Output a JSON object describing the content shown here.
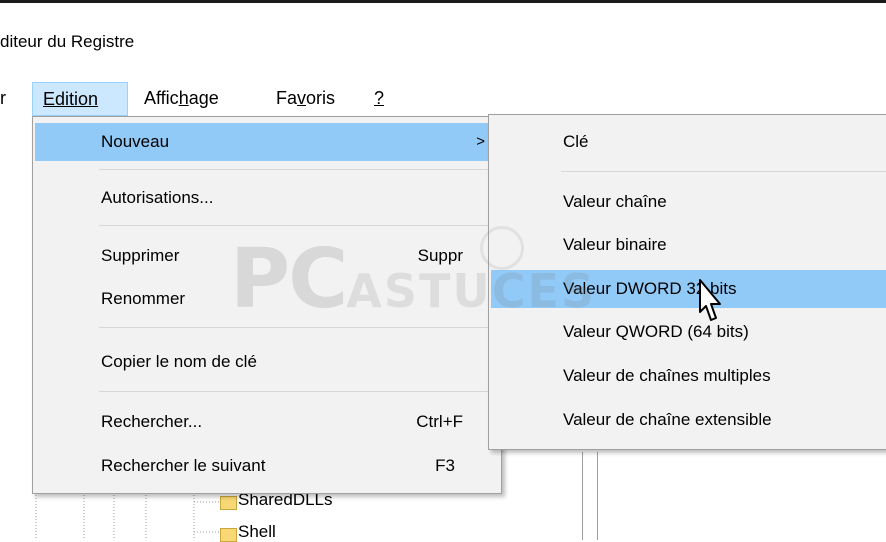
{
  "window": {
    "title": "diteur du Registre"
  },
  "menubar": {
    "items": [
      {
        "id": "fichier",
        "label": "r"
      },
      {
        "id": "edition",
        "label": "Edition",
        "accel_index": 0,
        "active": true
      },
      {
        "id": "affichage",
        "label": "Affichage",
        "accel_index": 5
      },
      {
        "id": "favoris",
        "label": "Favoris",
        "accel_index": 2
      },
      {
        "id": "aide",
        "label": "?",
        "accel_index": 0
      }
    ]
  },
  "edit_menu": {
    "items": [
      {
        "label": "Nouveau",
        "shortcut": "",
        "submenu_arrow": ">",
        "highlighted": true
      },
      {
        "label": "Autorisations...",
        "shortcut": ""
      },
      {
        "label": "Supprimer",
        "shortcut": "Suppr"
      },
      {
        "label": "Renommer",
        "shortcut": ""
      },
      {
        "label": "Copier le nom de clé",
        "shortcut": ""
      },
      {
        "label": "Rechercher...",
        "shortcut": "Ctrl+F"
      },
      {
        "label": "Rechercher le suivant",
        "shortcut": "F3"
      }
    ]
  },
  "new_submenu": {
    "items": [
      {
        "label": "Clé"
      },
      {
        "label": "Valeur chaîne"
      },
      {
        "label": "Valeur binaire"
      },
      {
        "label": "Valeur DWORD 32 bits",
        "highlighted": true
      },
      {
        "label": "Valeur QWORD (64 bits)"
      },
      {
        "label": "Valeur de chaînes multiples"
      },
      {
        "label": "Valeur de chaîne extensible"
      }
    ]
  },
  "tree": {
    "nodes": [
      {
        "label": "SharedDLLs"
      },
      {
        "label": "Shell"
      }
    ]
  },
  "watermark": {
    "main": "PC",
    "sub": "ASTUCES"
  },
  "colors": {
    "menu_highlight": "#91c9f7",
    "menubar_active": "#cce8ff",
    "menu_background": "#f2f2f2",
    "folder": "#f8d775"
  },
  "icons": {
    "folder": "folder-icon",
    "cursor": "pointer-cursor-icon",
    "watermark_bulb": "lightbulb-icon"
  }
}
